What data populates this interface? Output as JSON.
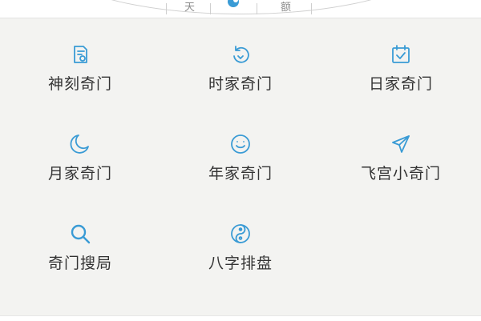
{
  "top_banner": {
    "left_char": "天",
    "right_char": "额"
  },
  "colors": {
    "accent": "#3a9bd5",
    "panel_bg": "#f3f3f1",
    "label_text": "#333333"
  },
  "menu": {
    "items": [
      {
        "label": "神刻奇门",
        "icon": "document-icon"
      },
      {
        "label": "时家奇门",
        "icon": "clock-arrow-icon"
      },
      {
        "label": "日家奇门",
        "icon": "calendar-check-icon"
      },
      {
        "label": "月家奇门",
        "icon": "moon-icon"
      },
      {
        "label": "年家奇门",
        "icon": "smile-icon"
      },
      {
        "label": "飞宫小奇门",
        "icon": "paper-plane-icon"
      },
      {
        "label": "奇门搜局",
        "icon": "search-icon"
      },
      {
        "label": "八字排盘",
        "icon": "yin-yang-icon"
      }
    ]
  }
}
